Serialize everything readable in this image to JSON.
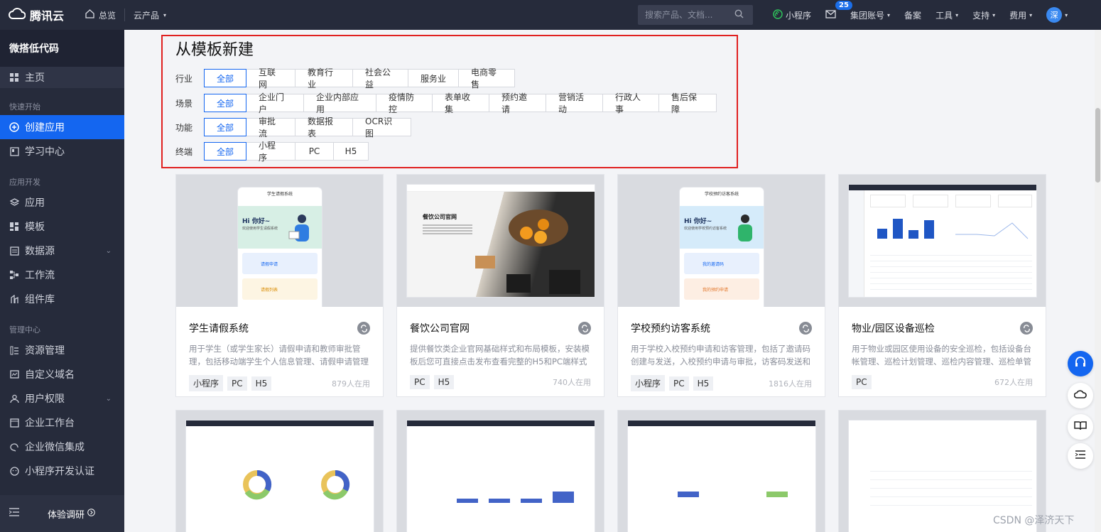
{
  "topbar": {
    "brand": "腾讯云",
    "overview": "总览",
    "cloud_products": "云产品",
    "search_placeholder": "搜索产品、文档...",
    "miniprogram": "小程序",
    "mail_badge": "25",
    "group_account": "集团账号",
    "record": "备案",
    "tools": "工具",
    "support": "支持",
    "billing": "费用",
    "avatar": "深"
  },
  "sidebar": {
    "title": "微搭低代码",
    "home": "主页",
    "group_quick": "快速开始",
    "create_app": "创建应用",
    "learning": "学习中心",
    "group_dev": "应用开发",
    "apps": "应用",
    "templates": "模板",
    "datasource": "数据源",
    "workflow": "工作流",
    "components": "组件库",
    "group_manage": "管理中心",
    "resources": "资源管理",
    "domain": "自定义域名",
    "permissions": "用户权限",
    "workbench": "企业工作台",
    "wecom": "企业微信集成",
    "mp_auth": "小程序开发认证",
    "survey": "体验调研"
  },
  "main": {
    "title": "从模板新建",
    "filters": [
      {
        "label": "行业",
        "options": [
          "全部",
          "互联网",
          "教育行业",
          "社会公益",
          "服务业",
          "电商零售"
        ]
      },
      {
        "label": "场景",
        "options": [
          "全部",
          "企业门户",
          "企业内部应用",
          "疫情防控",
          "表单收集",
          "预约邀请",
          "营销活动",
          "行政人事",
          "售后保障"
        ]
      },
      {
        "label": "功能",
        "options": [
          "全部",
          "审批流",
          "数据报表",
          "OCR识图"
        ]
      },
      {
        "label": "终端",
        "options": [
          "全部",
          "小程序",
          "PC",
          "H5"
        ]
      }
    ],
    "cards": [
      {
        "title": "学生请假系统",
        "desc": "用于学生（或学生家长）请假申请和教师审批管理，包括移动端学生个人信息管理、请假申请管理和PC...",
        "tags": [
          "小程序",
          "PC",
          "H5"
        ],
        "usage": "879人在用"
      },
      {
        "title": "餐饮公司官网",
        "desc": "提供餐饮类企业官网基础样式和布局模板，安装模板后您可直接点击发布查看完整的H5和PC端样式",
        "tags": [
          "PC",
          "H5"
        ],
        "usage": "740人在用"
      },
      {
        "title": "学校预约访客系统",
        "desc": "用于学校入校预约申请和访客管理，包括了邀请码创建与发送，入校预约申请与审批，访客码发送和展...",
        "tags": [
          "小程序",
          "PC",
          "H5"
        ],
        "usage": "1816人在用"
      },
      {
        "title": "物业/园区设备巡检",
        "desc": "用于物业或园区使用设备的安全巡检，包括设备台帐管理、巡检计划管理、巡检内容管理、巡检单管理...",
        "tags": [
          "PC"
        ],
        "usage": "672人在用"
      }
    ],
    "thumb_text": {
      "leave_app": "学生请假系统",
      "hi": "Hi 你好~",
      "leave_sub": "欢迎使用学生请假系统",
      "leave_apply": "请假申请",
      "leave_list": "请假列表",
      "restaurant": "餐饮公司官网",
      "visitor_app": "学校预约访客系统",
      "visitor_sub": "欢迎使用学校预约访客系统",
      "invite_code": "我的邀请码",
      "my_apply": "我的预约申请"
    }
  },
  "watermark": "CSDN @泽济天下",
  "colors": {
    "accent": "#1466f0",
    "highlight_box": "#e02020",
    "topbar_bg": "#262b3b"
  }
}
